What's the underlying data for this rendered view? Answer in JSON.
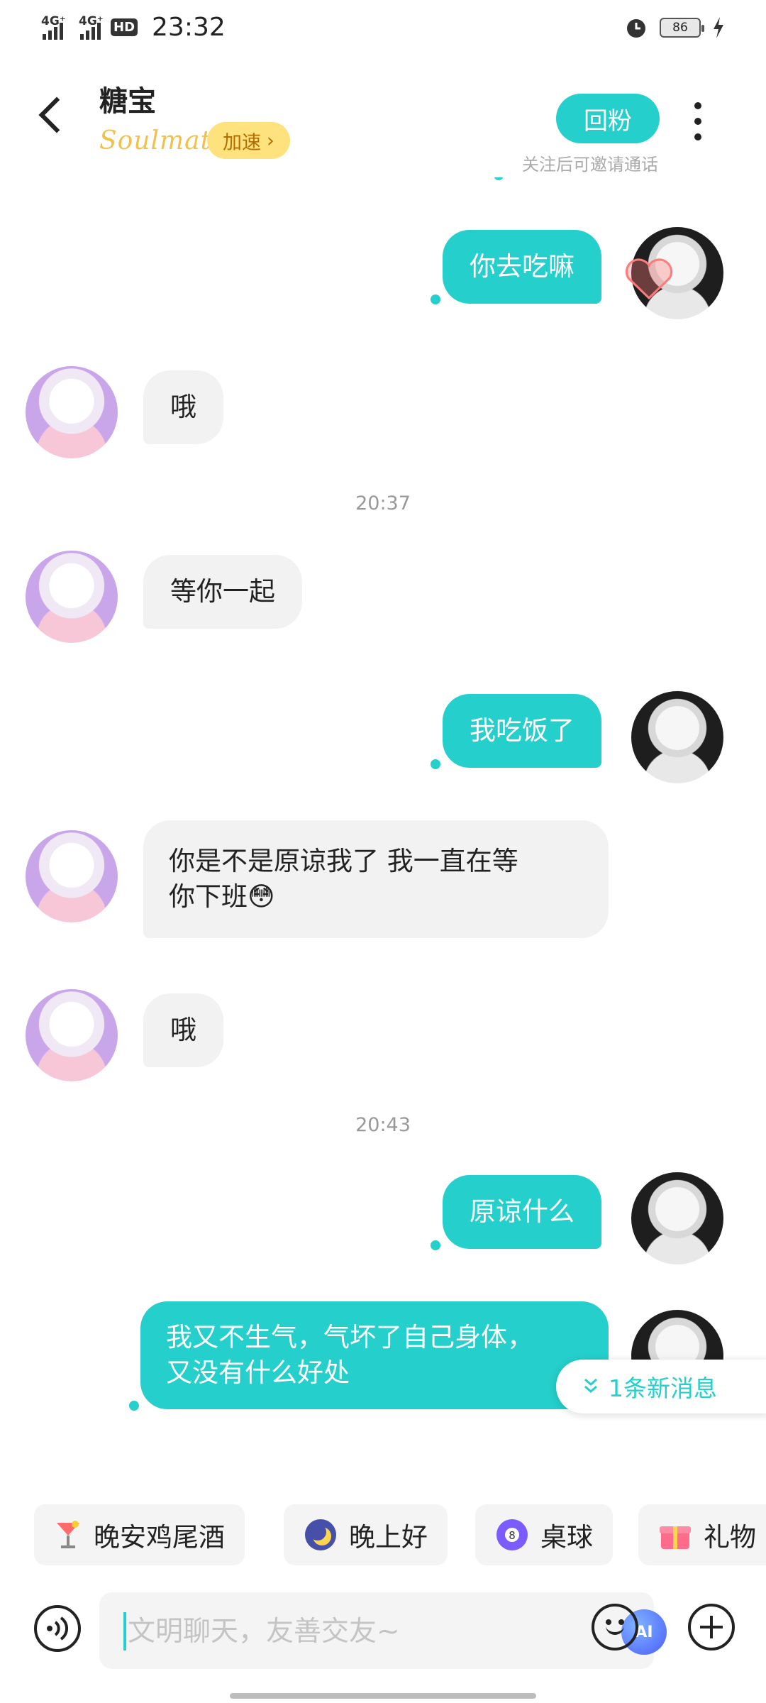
{
  "status": {
    "net1": "4G⁺",
    "net2": "4G⁺",
    "hd": "HD",
    "time": "23:32",
    "battery": "86"
  },
  "header": {
    "title": "糖宝",
    "tag": "Soulmate",
    "speed_label": "加速",
    "follow_label": "回粉",
    "follow_hint": "关注后可邀请通话"
  },
  "messages": [
    {
      "from": "me",
      "text": "你去吃嘛"
    },
    {
      "from": "them",
      "text": "哦"
    },
    {
      "timestamp": "20:37"
    },
    {
      "from": "them",
      "text": "等你一起"
    },
    {
      "from": "me",
      "text": "我吃饭了"
    },
    {
      "from": "them",
      "text_line1": "你是不是原谅我了  我一直在等",
      "text_line2": "你下班😳"
    },
    {
      "from": "them",
      "text": "哦"
    },
    {
      "timestamp": "20:43"
    },
    {
      "from": "me",
      "text": "原谅什么"
    },
    {
      "from": "me",
      "text_line1": "我又不生气，气坏了自己身体，",
      "text_line2": "又没有什么好处"
    }
  ],
  "new_messages": "1条新消息",
  "quick_replies": [
    {
      "icon": "cocktail-icon",
      "label": "晚安鸡尾酒"
    },
    {
      "icon": "moon-icon",
      "label": "晚上好"
    },
    {
      "icon": "billiard-icon",
      "label": "桌球"
    },
    {
      "icon": "gift-icon",
      "label": "礼物"
    }
  ],
  "input": {
    "placeholder": "文明聊天，友善交友~",
    "ai_label": "AI"
  },
  "colors": {
    "accent": "#25cfcb",
    "speed_bg": "#fde27e"
  }
}
